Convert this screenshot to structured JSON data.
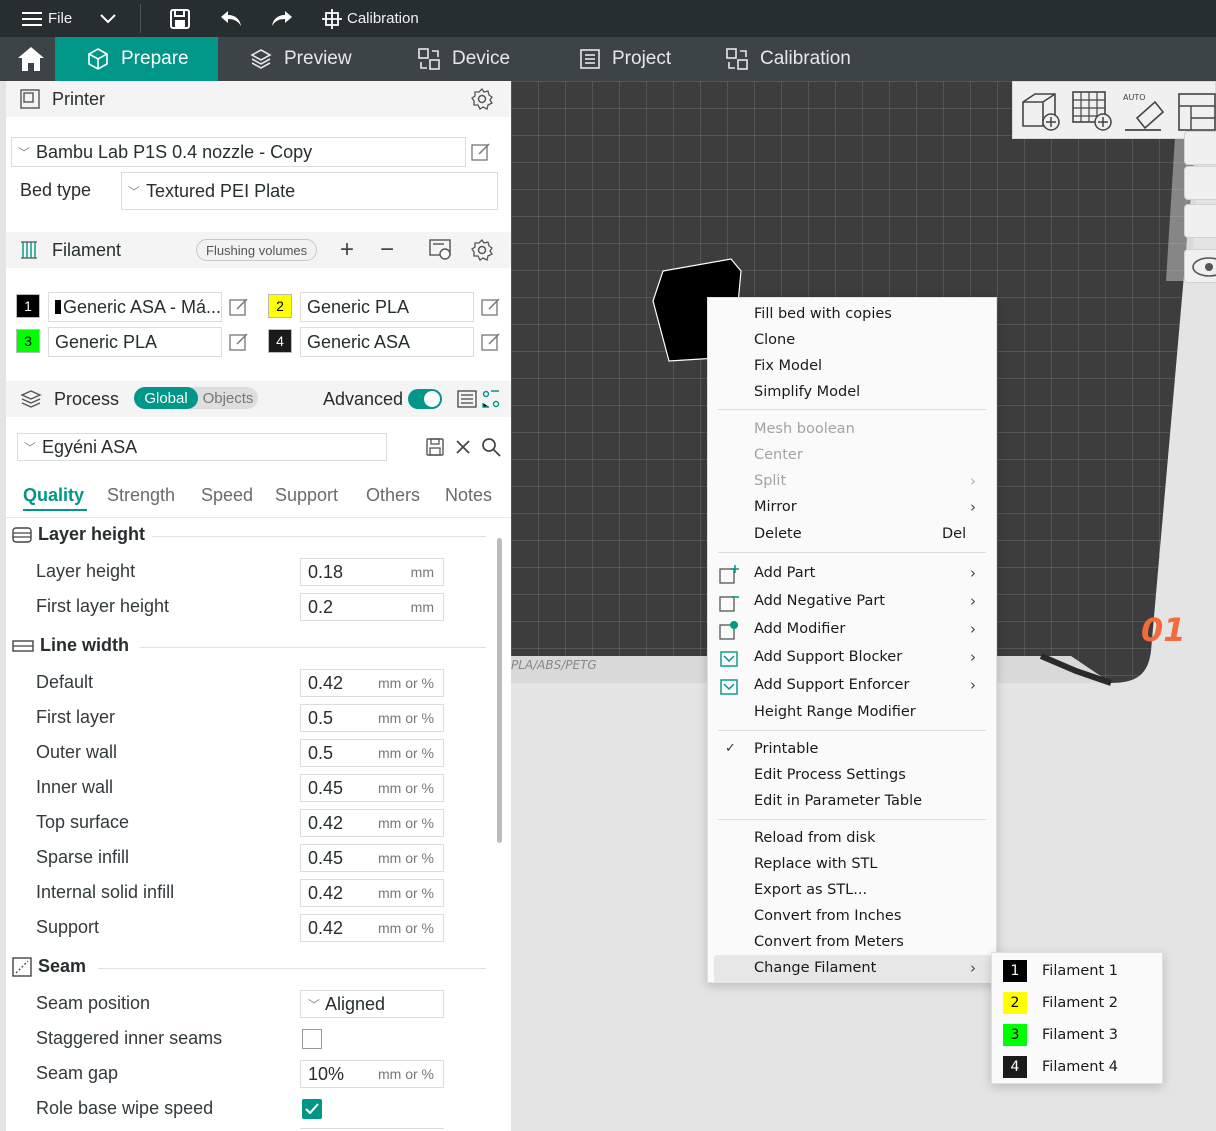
{
  "titlebar": {
    "file_label": "File",
    "calibration_label": "Calibration"
  },
  "tabs": [
    {
      "label": "Prepare"
    },
    {
      "label": "Preview"
    },
    {
      "label": "Device"
    },
    {
      "label": "Project"
    },
    {
      "label": "Calibration"
    }
  ],
  "printer": {
    "section_label": "Printer",
    "selected": "Bambu Lab P1S 0.4 nozzle - Copy",
    "bed_type_label": "Bed type",
    "bed_type_value": "Textured PEI Plate"
  },
  "filament": {
    "section_label": "Filament",
    "flushing_label": "Flushing volumes",
    "items": [
      {
        "index": "1",
        "name": "Generic ASA - Má...",
        "color": "#000000"
      },
      {
        "index": "2",
        "name": "Generic PLA",
        "color": "#ffff00"
      },
      {
        "index": "3",
        "name": "Generic PLA",
        "color": "#00ff00"
      },
      {
        "index": "4",
        "name": "Generic ASA",
        "color": "#1a1a1a"
      }
    ]
  },
  "process": {
    "section_label": "Process",
    "global_label": "Global",
    "objects_label": "Objects",
    "advanced_label": "Advanced",
    "advanced_on": true,
    "preset": "Egyéni ASA",
    "subtabs": [
      "Quality",
      "Strength",
      "Speed",
      "Support",
      "Others",
      "Notes"
    ],
    "active_subtab": "Quality"
  },
  "quality": {
    "layer_height_group": "Layer height",
    "layer_height_label": "Layer height",
    "layer_height_value": "0.18",
    "layer_height_unit": "mm",
    "first_layer_height_label": "First layer height",
    "first_layer_height_value": "0.2",
    "first_layer_height_unit": "mm",
    "line_width_group": "Line width",
    "line_width_unit": "mm or %",
    "line_widths": [
      {
        "label": "Default",
        "value": "0.42"
      },
      {
        "label": "First layer",
        "value": "0.5"
      },
      {
        "label": "Outer wall",
        "value": "0.5"
      },
      {
        "label": "Inner wall",
        "value": "0.45"
      },
      {
        "label": "Top surface",
        "value": "0.42"
      },
      {
        "label": "Sparse infill",
        "value": "0.45"
      },
      {
        "label": "Internal solid infill",
        "value": "0.42"
      },
      {
        "label": "Support",
        "value": "0.42"
      }
    ],
    "seam_group": "Seam",
    "seam_position_label": "Seam position",
    "seam_position_value": "Aligned",
    "staggered_label": "Staggered inner seams",
    "staggered_checked": false,
    "seam_gap_label": "Seam gap",
    "seam_gap_value": "10%",
    "seam_gap_unit": "mm or %",
    "wipe_speed_label": "Role base wipe speed",
    "wipe_speed_checked": true
  },
  "plate": {
    "number": "01",
    "bed_text": "PLA/ABS/PETG"
  },
  "context_menu": {
    "fill_bed": "Fill bed with copies",
    "clone": "Clone",
    "fix_model": "Fix Model",
    "simplify": "Simplify Model",
    "mesh_boolean": "Mesh boolean",
    "center": "Center",
    "split": "Split",
    "mirror": "Mirror",
    "delete": "Delete",
    "delete_shortcut": "Del",
    "add_part": "Add Part",
    "add_negative_part": "Add Negative Part",
    "add_modifier": "Add Modifier",
    "add_support_blocker": "Add Support Blocker",
    "add_support_enforcer": "Add Support Enforcer",
    "height_range_modifier": "Height Range Modifier",
    "printable": "Printable",
    "edit_process": "Edit Process Settings",
    "edit_param_table": "Edit in Parameter Table",
    "reload": "Reload from disk",
    "replace_stl": "Replace with STL",
    "export_stl": "Export as STL...",
    "convert_inches": "Convert from Inches",
    "convert_meters": "Convert from Meters",
    "change_filament": "Change Filament"
  },
  "filament_submenu": [
    {
      "index": "1",
      "label": "Filament 1",
      "color": "#000000",
      "text_color": "#ffffff"
    },
    {
      "index": "2",
      "label": "Filament 2",
      "color": "#ffff00",
      "text_color": "#000000"
    },
    {
      "index": "3",
      "label": "Filament 3",
      "color": "#00ff00",
      "text_color": "#000000"
    },
    {
      "index": "4",
      "label": "Filament 4",
      "color": "#1a1a1a",
      "text_color": "#ffffff"
    }
  ],
  "colors": {
    "accent": "#009688",
    "titlebar": "#262e30",
    "tabbar": "#3c4447",
    "plate_number": "#f26b3a"
  }
}
